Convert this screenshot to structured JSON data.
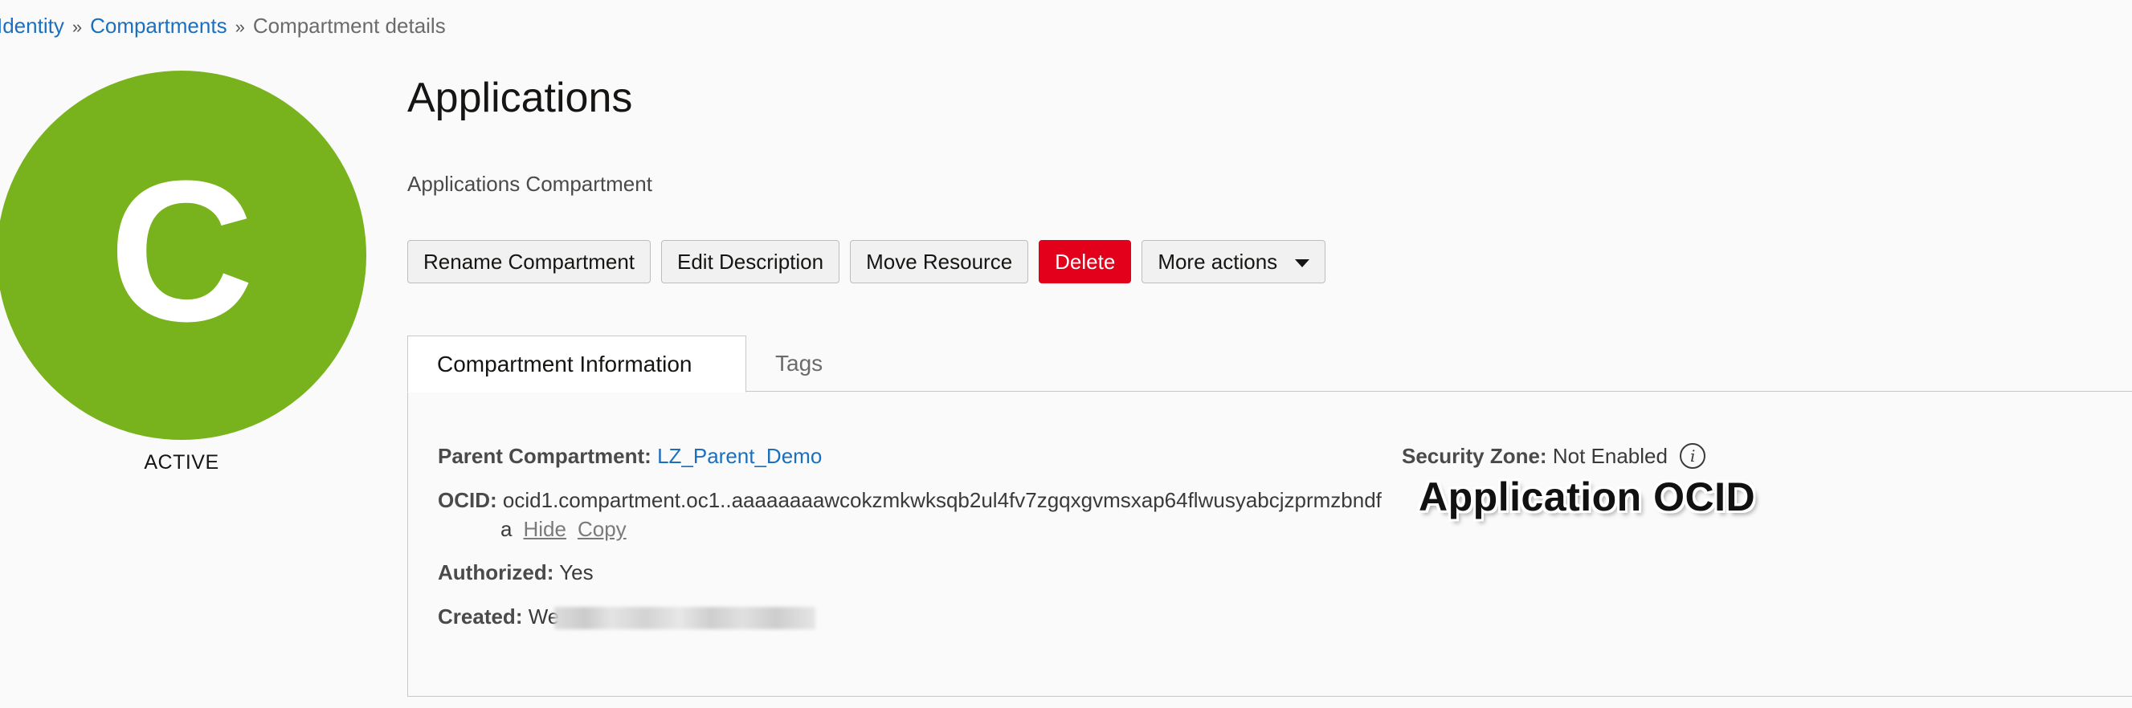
{
  "breadcrumb": {
    "identity": "Identity",
    "compartments": "Compartments",
    "current": "Compartment details",
    "separator": "»"
  },
  "avatar": {
    "letter": "C",
    "color": "#78b31d",
    "state": "ACTIVE"
  },
  "header": {
    "title": "Applications",
    "description": "Applications Compartment"
  },
  "actions": {
    "rename": "Rename Compartment",
    "edit_description": "Edit Description",
    "move": "Move Resource",
    "delete": "Delete",
    "more": "More actions",
    "more_icon": "caret-down-icon",
    "delete_color": "#e3001b"
  },
  "tabs": {
    "info": "Compartment Information",
    "tags": "Tags"
  },
  "info": {
    "parent_label": "Parent Compartment:",
    "parent_value": "LZ_Parent_Demo",
    "ocid_label": "OCID:",
    "ocid_value": "ocid1.compartment.oc1..aaaaaaaawcokzmkwksqb2ul4fv7zgqxgvmsxap64flwusyabcjzprmzbndf",
    "ocid_tail": "a",
    "hide": "Hide",
    "copy": "Copy",
    "authorized_label": "Authorized:",
    "authorized_value": "Yes",
    "created_label": "Created:",
    "created_value": "We",
    "security_zone_label": "Security Zone:",
    "security_zone_value": "Not Enabled",
    "security_zone_icon": "info-icon"
  },
  "annotation": "Application OCID",
  "colors": {
    "link": "#1b6fbf",
    "danger": "#e3001b",
    "avatar": "#78b31d"
  }
}
